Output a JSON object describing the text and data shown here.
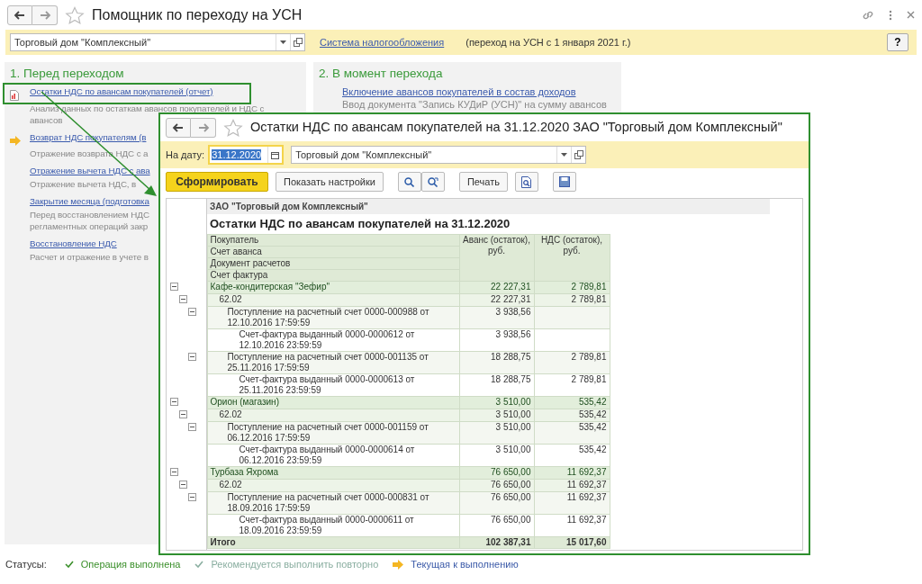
{
  "window": {
    "title": "Помощник по переходу на УСН"
  },
  "header": {
    "organization": "Торговый дом \"Комплексный\"",
    "link": "Система налогообложения",
    "note": "(переход на УСН с 1 января 2021 г.)",
    "help": "?"
  },
  "sections": [
    {
      "title": "1. Перед переходом",
      "items": [
        {
          "kind": "report",
          "highlighted": true,
          "link": "Остатки НДС по авансам покупателей (отчет)",
          "description": [
            "Анализ данных по остаткам авансов покупателей и НДС с",
            "авансов"
          ]
        },
        {
          "kind": "current",
          "highlighted": false,
          "link": "Возврат НДС покупателям (в",
          "description": [
            "Отражение возврата НДС с а"
          ]
        },
        {
          "kind": "step",
          "highlighted": false,
          "link": "Отражение вычета НДС с ава",
          "description": [
            "Отражение вычета НДС, в"
          ]
        },
        {
          "kind": "step",
          "highlighted": false,
          "link": "Закрытие месяца (подготовка",
          "description": [
            "Перед восстановлением НДС",
            "регламентных операций закр"
          ]
        },
        {
          "kind": "step",
          "highlighted": false,
          "link": "Восстановление НДС",
          "description": [
            "Расчет и отражение в учете в"
          ]
        }
      ]
    },
    {
      "title": "2. В момент перехода",
      "items": [
        {
          "kind": "step",
          "highlighted": false,
          "link": "Включение авансов покупателей в состав доходов",
          "description": [
            "Ввод документа \"Запись КУДиР (УСН)\" на сумму авансов"
          ]
        }
      ]
    }
  ],
  "report_window": {
    "title": "Остатки НДС по авансам покупателей на 31.12.2020 ЗАО \"Торговый дом Комплексный\"",
    "date_label": "На дату:",
    "date": "31.12.2020",
    "organization": "Торговый дом \"Комплексный\"",
    "generate_button": "Сформировать",
    "settings_button": "Показать настройки",
    "print_button": "Печать",
    "report": {
      "company": "ЗАО \"Торговый дом Комплексный\"",
      "title": "Остатки НДС по авансам покупателей на 31.12.2020",
      "group_headers": [
        "Покупатель",
        "Счет аванса",
        "Документ расчетов",
        "Счет фактура"
      ],
      "columns": [
        "Аванс (остаток), руб.",
        "НДС (остаток), руб."
      ],
      "rows": [
        {
          "name": "Кафе-кондитерская \"Зефир\"",
          "advance": "22 227,31",
          "vat": "2 789,81",
          "expanded": true,
          "children": [
            {
              "name": "62.02",
              "advance": "22 227,31",
              "vat": "2 789,81",
              "expanded": true,
              "children": [
                {
                  "name": "Поступление на расчетный счет 0000-000988 от 12.10.2016 17:59:59",
                  "advance": "3 938,56",
                  "expanded": true,
                  "children": [
                    {
                      "name": "Счет-фактура выданный 0000-0000612 от 12.10.2016 23:59:59",
                      "advance": "3 938,56"
                    }
                  ]
                },
                {
                  "name": "Поступление на расчетный счет 0000-001135 от 25.11.2016 17:59:59",
                  "advance": "18 288,75",
                  "vat": "2 789,81",
                  "expanded": true,
                  "children": [
                    {
                      "name": "Счет-фактура выданный 0000-0000613 от 25.11.2016 23:59:59",
                      "advance": "18 288,75",
                      "vat": "2 789,81"
                    }
                  ]
                }
              ]
            }
          ]
        },
        {
          "name": "Орион (магазин)",
          "advance": "3 510,00",
          "vat": "535,42",
          "expanded": true,
          "children": [
            {
              "name": "62.02",
              "advance": "3 510,00",
              "vat": "535,42",
              "expanded": true,
              "children": [
                {
                  "name": "Поступление на расчетный счет 0000-001159 от 06.12.2016 17:59:59",
                  "advance": "3 510,00",
                  "vat": "535,42",
                  "expanded": true,
                  "children": [
                    {
                      "name": "Счет-фактура выданный 0000-0000614 от 06.12.2016 23:59:59",
                      "advance": "3 510,00",
                      "vat": "535,42"
                    }
                  ]
                }
              ]
            }
          ]
        },
        {
          "name": "Турбаза Яхрома",
          "advance": "76 650,00",
          "vat": "11 692,37",
          "expanded": true,
          "children": [
            {
              "name": "62.02",
              "advance": "76 650,00",
              "vat": "11 692,37",
              "expanded": true,
              "children": [
                {
                  "name": "Поступление на расчетный счет 0000-000831 от 18.09.2016 17:59:59",
                  "advance": "76 650,00",
                  "vat": "11 692,37",
                  "expanded": true,
                  "children": [
                    {
                      "name": "Счет-фактура выданный 0000-0000611 от 18.09.2016 23:59:59",
                      "advance": "76 650,00",
                      "vat": "11 692,37"
                    }
                  ]
                }
              ]
            }
          ]
        }
      ],
      "total": {
        "name": "Итого",
        "advance": "102 387,31",
        "vat": "15 017,60"
      }
    }
  },
  "statuses": {
    "label": "Статусы:",
    "items": [
      {
        "kind": "done",
        "text": "Операция выполнена"
      },
      {
        "kind": "repeat",
        "text": "Рекомендуется выполнить повторно"
      },
      {
        "kind": "current",
        "text": "Текущая к выполнению"
      }
    ]
  }
}
